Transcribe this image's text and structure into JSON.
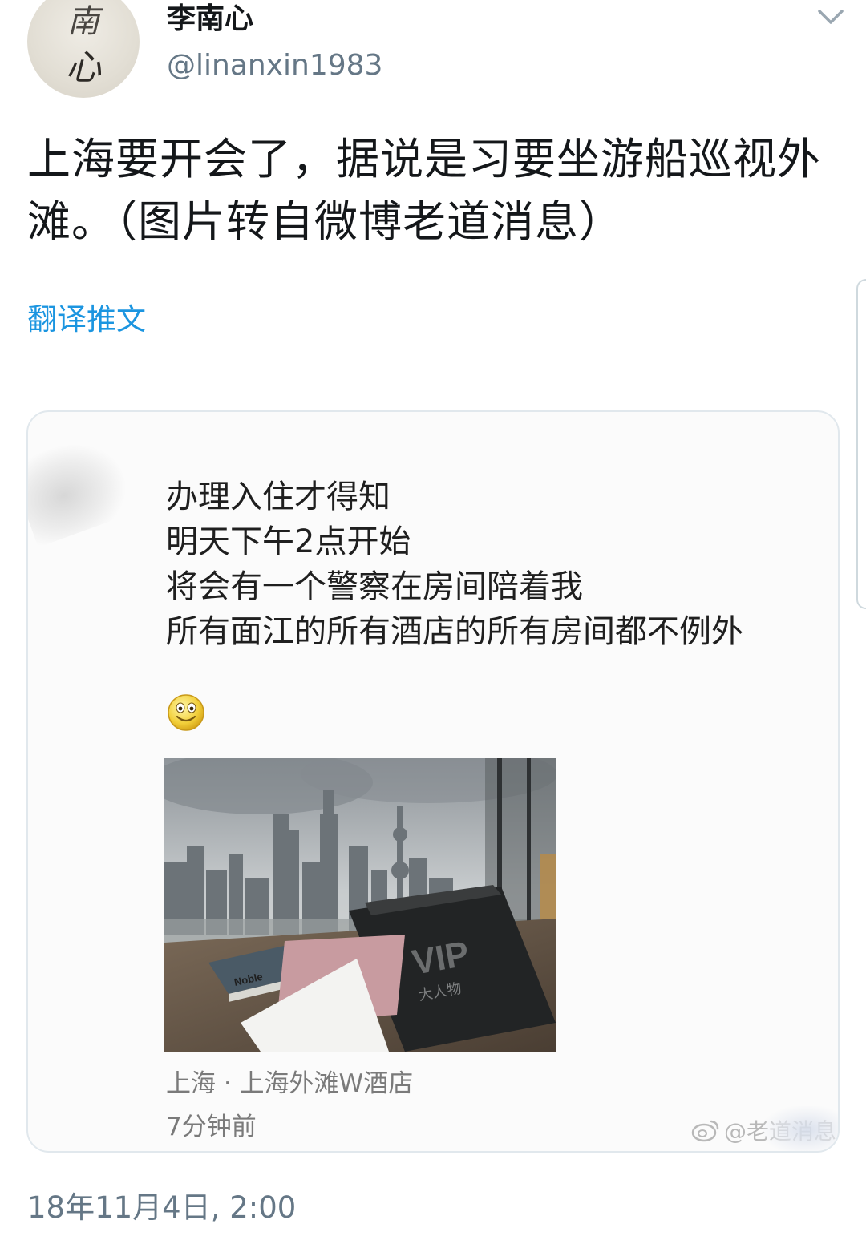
{
  "author": {
    "display_name": "李南心",
    "handle": "@linanxin1983",
    "avatar_text_top": "南",
    "avatar_text_bottom": "心"
  },
  "tweet": {
    "text": "上海要开会了，据说是习要坐游船巡视外滩。（图片转自微博老道消息）",
    "translate_label": "翻译推文",
    "timestamp": "18年11月4日, 2:00"
  },
  "media": {
    "post_lines": [
      "办理入住才得知",
      "明天下午2点开始",
      "将会有一个警察在房间陪着我",
      "所有面江的所有酒店的所有房间都不例外"
    ],
    "photo_labels": {
      "book": "Noble",
      "card": "VIP",
      "card_sub": "大人物"
    },
    "location": "上海 · 上海外滩W酒店",
    "time_ago": "7分钟前",
    "watermark": "@老道消息"
  },
  "icons": {
    "menu": "chevron-down-icon",
    "emoji": "smiley-face-icon",
    "watermark_logo": "weibo-logo-icon"
  },
  "colors": {
    "link": "#1b95e0",
    "secondary_text": "#657786",
    "card_border": "#e1e8ed"
  }
}
